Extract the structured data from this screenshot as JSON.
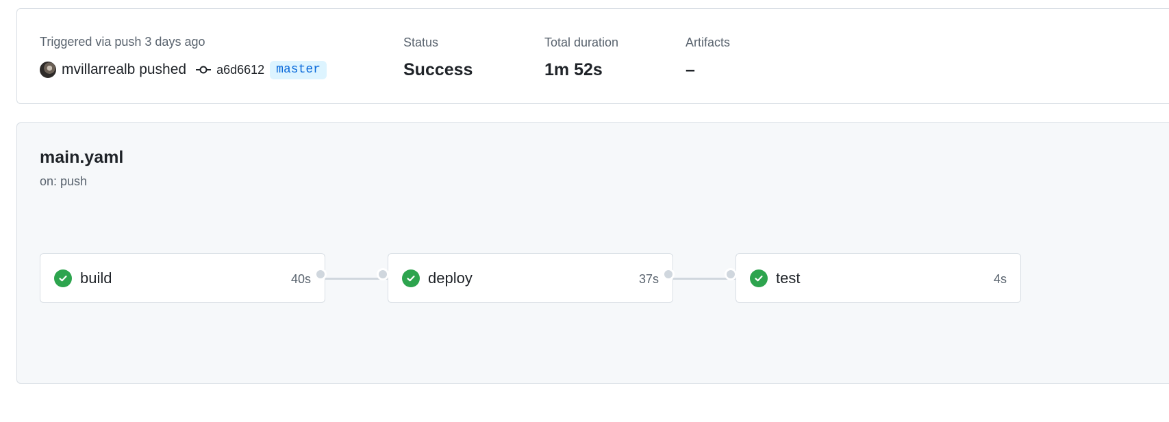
{
  "summary": {
    "trigger_label": "Triggered via push 3 days ago",
    "user_action": "mvillarrealb pushed",
    "commit_sha": "a6d6612",
    "branch": "master",
    "status_label": "Status",
    "status_value": "Success",
    "duration_label": "Total duration",
    "duration_value": "1m 52s",
    "artifacts_label": "Artifacts",
    "artifacts_value": "–"
  },
  "workflow": {
    "name": "main.yaml",
    "trigger": "on: push",
    "jobs": [
      {
        "name": "build",
        "duration": "40s",
        "status": "success",
        "icon": "check-circle-icon"
      },
      {
        "name": "deploy",
        "duration": "37s",
        "status": "success",
        "icon": "check-circle-icon"
      },
      {
        "name": "test",
        "duration": "4s",
        "status": "success",
        "icon": "check-circle-icon"
      }
    ]
  },
  "colors": {
    "success": "#2da44e",
    "branch_text": "#0969da",
    "branch_bg": "#ddf4ff",
    "muted_text": "#59636e"
  }
}
